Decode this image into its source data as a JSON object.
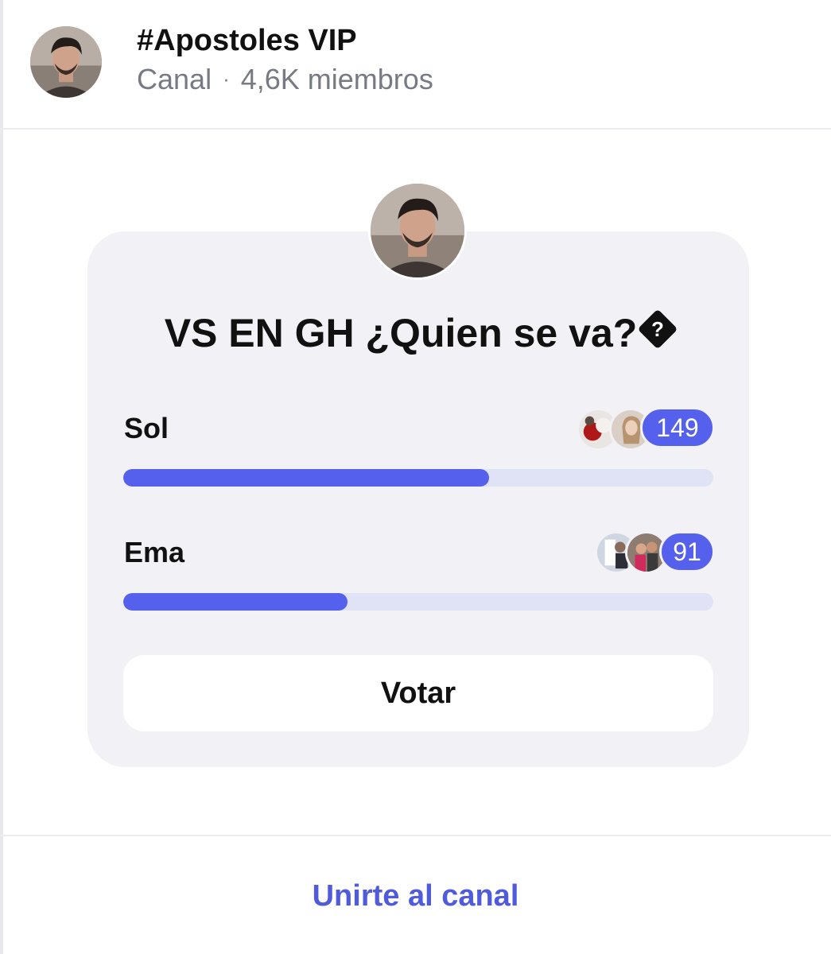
{
  "header": {
    "channel_name": "#Apostoles VIP",
    "channel_type": "Canal",
    "separator": "·",
    "members": "4,6K miembros",
    "avatar_icon": "profile-photo-icon"
  },
  "poll": {
    "title": "VS EN GH ¿Quien se va?",
    "title_icon_glyph": "?",
    "options": [
      {
        "label": "Sol",
        "votes": "149",
        "fraction": 0.62
      },
      {
        "label": "Ema",
        "votes": "91",
        "fraction": 0.38
      }
    ],
    "vote_button_label": "Votar"
  },
  "footer": {
    "join_label": "Unirte al canal"
  },
  "colors": {
    "accent": "#5561ec",
    "track": "#e0e2f5",
    "card_background": "#f1f1f6",
    "link": "#4f5bdc",
    "muted_text": "#777a82"
  }
}
